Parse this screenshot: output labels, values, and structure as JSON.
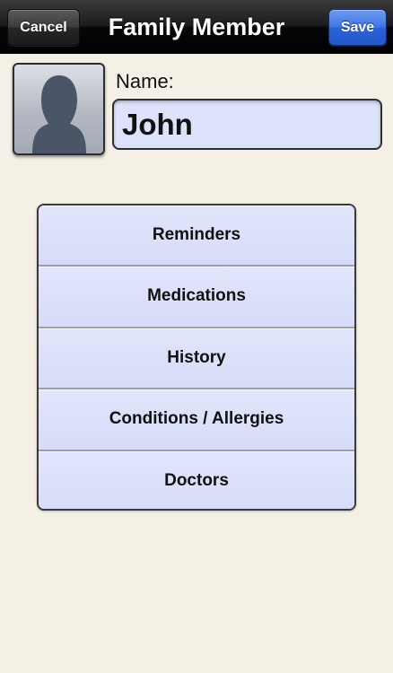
{
  "navbar": {
    "title": "Family Member",
    "cancel_label": "Cancel",
    "save_label": "Save"
  },
  "profile": {
    "avatar_icon": "person-silhouette-icon",
    "name_label": "Name:",
    "name_value": "John"
  },
  "menu": {
    "items": [
      {
        "label": "Reminders"
      },
      {
        "label": "Medications"
      },
      {
        "label": "History"
      },
      {
        "label": "Conditions / Allergies"
      },
      {
        "label": "Doctors"
      }
    ]
  },
  "colors": {
    "navbar": "#000000",
    "save_button": "#2f68de",
    "background": "#f4f0e6",
    "field_fill": "#dde2fb"
  }
}
